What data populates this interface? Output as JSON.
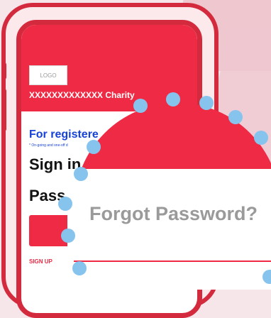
{
  "header": {
    "logo_text": "LOGO",
    "charity_name": "XXXXXXXXXXXXX Charity"
  },
  "content": {
    "for_registered": "For registere",
    "ongoing_note": "* On-going and one-off d",
    "sign_in": "Sign in",
    "password": "Pass",
    "sign_up": "SIGN UP"
  },
  "magnifier": {
    "forgot_password": "Forgot Password?"
  },
  "colors": {
    "brand_red": "#ee2a44",
    "phone_frame": "#d42a3d",
    "link_blue": "#1642d6",
    "dot_blue": "#86c4ee"
  }
}
